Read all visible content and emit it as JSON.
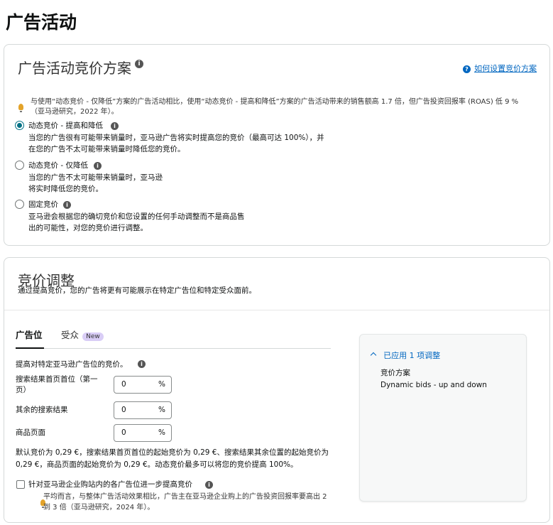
{
  "page_title": "广告活动",
  "bidding": {
    "title": "广告活动竞价方案",
    "help_link": "如何设置竞价方案",
    "tip": "与使用“动态竞价 - 仅降低”方案的广告活动相比，使用“动态竞价 - 提高和降低”方案的广告活动带来的销售额高 1.7 倍，但广告投资回报率 (ROAS) 低 9 %",
    "tip_source": "（亚马逊研究，2022 年）。",
    "options": [
      {
        "label": "动态竞价 - 提高和降低",
        "desc1": "当您的广告很有可能带来销量时，亚马逊广告将实时提高您的竞价（最高可达 100%），并",
        "desc2": "在您的广告不太可能带来销量时降低您的竞价。",
        "selected": true
      },
      {
        "label": "动态竞价 - 仅降低",
        "desc1": "当您的广告不太可能带来销量时，亚马逊",
        "desc2": "将实时降低您的竞价。",
        "selected": false
      },
      {
        "label": "固定竞价",
        "desc1": "亚马逊会根据您的确切竞价和您设置的任何手动调整而不是商品售",
        "desc2": "出的可能性，对您的竞价进行调整。",
        "selected": false
      }
    ]
  },
  "adjust": {
    "title": "竞价调整",
    "subtitle": "通过提高竞价，您的广告将更有可能展示在特定广告位和特定受众面前。",
    "tabs": [
      {
        "label": "广告位",
        "active": true
      },
      {
        "label": "受众",
        "active": false,
        "badge": "New"
      }
    ],
    "increase_label": "提高对特定亚马逊广告位的竞价。",
    "rows": [
      {
        "label_line1": "搜索结果首页首位（第一",
        "label_line2": "页）",
        "value": "0",
        "unit": "%"
      },
      {
        "label_line1": "其余的搜索结果",
        "label_line2": "",
        "value": "0",
        "unit": "%"
      },
      {
        "label_line1": "商品页面",
        "label_line2": "",
        "value": "0",
        "unit": "%"
      }
    ],
    "default_note_1": "默认竞价为 0,29 €，搜索结果首页首位的起始竞价为 0,29 €、搜索结果其余位置的起始竞价为",
    "default_note_2": "0,29 €，商品页面的起始竞价为 0,29 €。动态竞价最多可以将您的竞价提高 100%。",
    "b2b_label": "针对亚马逊企业购站内的各广告位进一步提高竞价",
    "b2b_tip_1": "平均而言，与整体广告活动效果相比，广告主在亚马逊企业购上的广告投资回报率要高出 2",
    "b2b_tip_2": "到 3 倍（亚马逊研究，2024 年）。",
    "panel": {
      "header": "已应用 1 项调整",
      "item_label": "竞价方案",
      "item_value": "Dynamic bids - up and down"
    }
  }
}
